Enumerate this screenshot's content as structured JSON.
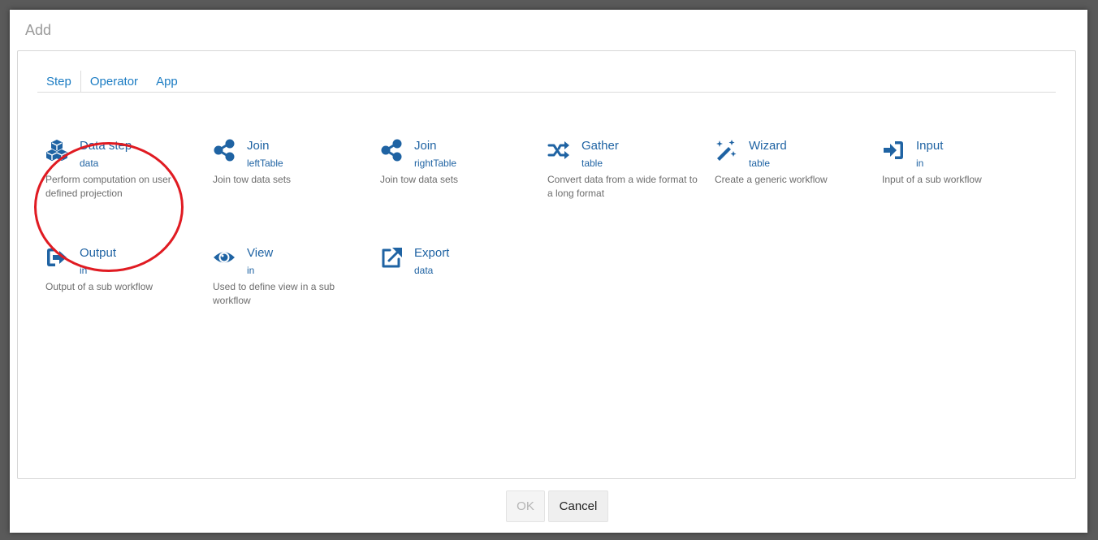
{
  "dialog": {
    "title": "Add"
  },
  "tabs": [
    {
      "label": "Step",
      "active": true
    },
    {
      "label": "Operator",
      "active": false
    },
    {
      "label": "App",
      "active": false
    }
  ],
  "items": [
    {
      "name": "Data step",
      "port": "data",
      "description": "Perform computation on user defined projection",
      "icon": "cubes-icon"
    },
    {
      "name": "Join",
      "port": "leftTable",
      "description": "Join tow data sets",
      "icon": "share-icon"
    },
    {
      "name": "Join",
      "port": "rightTable",
      "description": "Join tow data sets",
      "icon": "share-icon"
    },
    {
      "name": "Gather",
      "port": "table",
      "description": "Convert data from a wide format to a long format",
      "icon": "shuffle-icon"
    },
    {
      "name": "Wizard",
      "port": "table",
      "description": "Create a generic workflow",
      "icon": "magic-wand-icon"
    },
    {
      "name": "Input",
      "port": "in",
      "description": "Input of a sub workflow",
      "icon": "sign-in-icon"
    },
    {
      "name": "Output",
      "port": "in",
      "description": "Output of a sub workflow",
      "icon": "sign-out-icon"
    },
    {
      "name": "View",
      "port": "in",
      "description": "Used to define view in a sub workflow",
      "icon": "eye-icon"
    },
    {
      "name": "Export",
      "port": "data",
      "description": "",
      "icon": "external-link-icon"
    }
  ],
  "footer": {
    "ok_label": "OK",
    "cancel_label": "Cancel"
  },
  "colors": {
    "accent": "#1f63a3",
    "tab": "#1b7cc3",
    "annotation": "#e01b22"
  }
}
